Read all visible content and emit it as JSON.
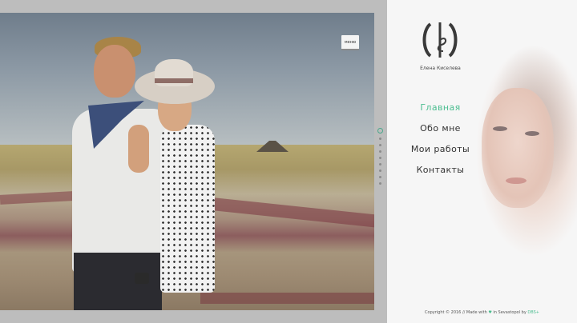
{
  "hero": {
    "menu_label": "меню",
    "slides_count": 9,
    "active_slide": 1
  },
  "sidebar": {
    "logo_icon": "monogram-logo",
    "name": "Елена Киселева",
    "nav": [
      {
        "label": "Главная",
        "active": true
      },
      {
        "label": "Обо мне",
        "active": false
      },
      {
        "label": "Мои работы",
        "active": false
      },
      {
        "label": "Контакты",
        "active": false
      }
    ]
  },
  "footer": {
    "prefix": "Copyright © 2016 // Made with ",
    "heart": "♥",
    "middle": " in Sevastopol  by ",
    "brand": "DBS+"
  },
  "colors": {
    "accent": "#4bbd8f",
    "panel_bg": "#f6f6f6",
    "page_bg": "#bdbdbd"
  }
}
